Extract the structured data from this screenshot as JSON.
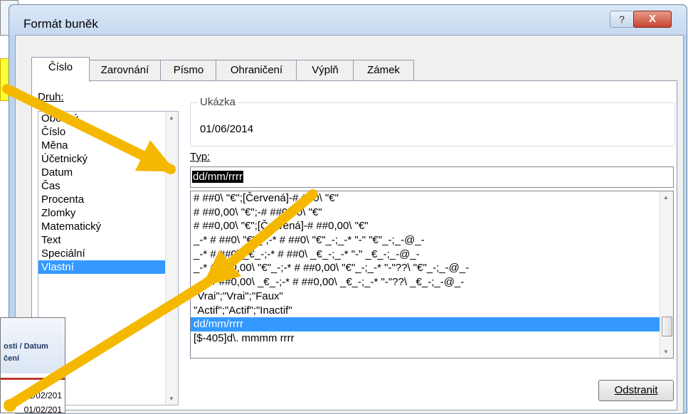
{
  "window": {
    "title": "Formát buněk",
    "help_label": "?",
    "close_label": "X"
  },
  "tabs": [
    {
      "label": "Číslo",
      "active": true
    },
    {
      "label": "Zarovnání",
      "active": false
    },
    {
      "label": "Písmo",
      "active": false
    },
    {
      "label": "Ohraničení",
      "active": false
    },
    {
      "label": "Výplň",
      "active": false
    },
    {
      "label": "Zámek",
      "active": false
    }
  ],
  "druh": {
    "label": "Druh:",
    "items": [
      "Obecný",
      "Číslo",
      "Měna",
      "Účetnický",
      "Datum",
      "Čas",
      "Procenta",
      "Zlomky",
      "Matematický",
      "Text",
      "Speciální",
      "Vlastní"
    ],
    "selected": "Vlastní"
  },
  "sample": {
    "label": "Ukázka",
    "value": "01/06/2014"
  },
  "typ": {
    "label": "Typ:",
    "value": "dd/mm/rrrr"
  },
  "formats": {
    "items": [
      "# ##0\\ \"€\";[Červená]-# ##0\\ \"€\"",
      "# ##0,00\\ \"€\";-# ##0,00\\ \"€\"",
      "# ##0,00\\ \"€\";[Červená]-# ##0,00\\ \"€\"",
      "_-* # ##0\\ \"€\"_-;-* # ##0\\ \"€\"_-;_-* \"-\" \"€\"_-;_-@_-",
      "_-* # ##0\\ _€_-;-* # ##0\\ _€_-;_-* \"-\" _€_-;_-@_-",
      "_-* # ##0,00\\ \"€\"_-;-* # ##0,00\\ \"€\"_-;_-* \"-\"??\\ \"€\"_-;_-@_-",
      "_-* # ##0,00\\ _€_-;-* # ##0,00\\ _€_-;_-* \"-\"??\\ _€_-;_-@_-",
      "\"Vrai\";\"Vrai\";\"Faux\"",
      "\"Actif\";\"Actif\";\"Inactif\"",
      "dd/mm/rrrr",
      "[$-405]d\\. mmmm rrrr"
    ],
    "selected": "dd/mm/rrrr"
  },
  "delete_button": "Odstranit",
  "excel": {
    "header": [
      "osti / Datum",
      "čení"
    ],
    "cells": [
      "01/02/201",
      "01/02/201"
    ]
  },
  "colors": {
    "arrow": "#f5b800",
    "selection": "#3399ff",
    "close": "#c74630"
  }
}
